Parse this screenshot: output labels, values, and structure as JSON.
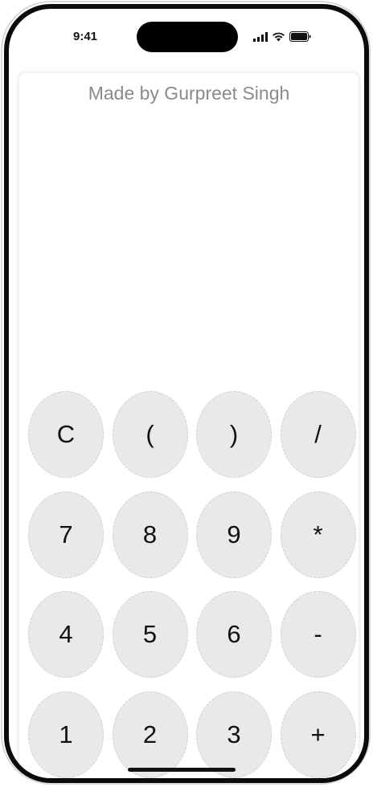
{
  "status_bar": {
    "time": "9:41",
    "signal_icon": "cellular-signal-icon",
    "wifi_icon": "wifi-icon",
    "battery_icon": "battery-icon"
  },
  "app": {
    "credit": "Made by Gurpreet Singh",
    "display_value": ""
  },
  "keypad": {
    "row1": [
      "C",
      "(",
      ")",
      "/"
    ],
    "row2": [
      "7",
      "8",
      "9",
      "*"
    ],
    "row3": [
      "4",
      "5",
      "6",
      "-"
    ],
    "row4": [
      "1",
      "2",
      "3",
      "+"
    ]
  },
  "colors": {
    "key_background": "#e9e9e9",
    "frame": "#0b0b0b",
    "credit_text": "#8a8a8a"
  }
}
